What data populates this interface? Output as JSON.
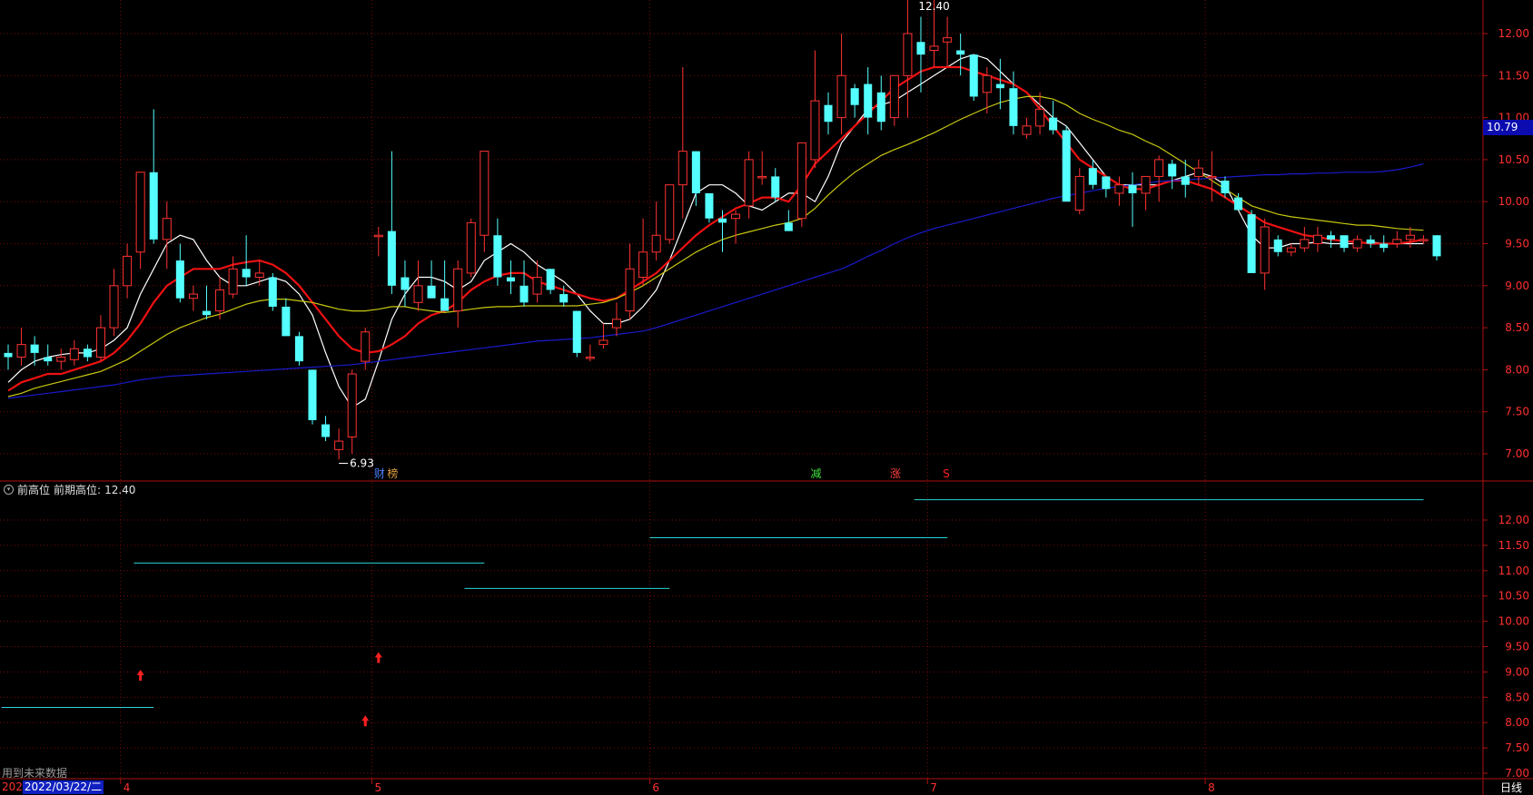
{
  "chart_data": {
    "type": "candlestick",
    "period": "日线",
    "price_axis": {
      "min": 6.7,
      "max": 12.55,
      "ticks": [
        "12.00",
        "11.50",
        "11.00",
        "10.50",
        "10.00",
        "9.50",
        "9.00",
        "8.50",
        "8.00",
        "7.50",
        "7.00"
      ]
    },
    "current_price_label": "10.79",
    "indicator_axis": {
      "min": 6.7,
      "max": 12.55,
      "ticks": [
        "12.00",
        "11.50",
        "11.00",
        "10.50",
        "10.00",
        "9.50",
        "9.00",
        "8.50",
        "8.00",
        "7.50",
        "7.00"
      ]
    },
    "month_labels": [
      {
        "label": "4",
        "index": 9
      },
      {
        "label": "5",
        "index": 28
      },
      {
        "label": "6",
        "index": 49
      },
      {
        "label": "7",
        "index": 70
      },
      {
        "label": "8",
        "index": 91
      }
    ],
    "annotations": {
      "high": "12.40",
      "low": "6.93"
    },
    "markers": [
      {
        "text": "财",
        "index": 28,
        "color": "#4a80ff"
      },
      {
        "text": "榜",
        "index": 29,
        "color": "#e0a040"
      },
      {
        "text": "减",
        "index": 61,
        "color": "#40e040"
      },
      {
        "text": "涨",
        "index": 67,
        "color": "#ff4040"
      },
      {
        "text": "S",
        "index": 71,
        "color": "#ff2020"
      }
    ],
    "candles": [
      {
        "o": 8.2,
        "h": 8.3,
        "l": 8.0,
        "c": 8.15
      },
      {
        "o": 8.15,
        "h": 8.5,
        "l": 8.05,
        "c": 8.3
      },
      {
        "o": 8.3,
        "h": 8.4,
        "l": 8.05,
        "c": 8.2
      },
      {
        "o": 8.15,
        "h": 8.3,
        "l": 8.05,
        "c": 8.1
      },
      {
        "o": 8.1,
        "h": 8.25,
        "l": 8.0,
        "c": 8.15
      },
      {
        "o": 8.12,
        "h": 8.35,
        "l": 8.05,
        "c": 8.25
      },
      {
        "o": 8.25,
        "h": 8.3,
        "l": 8.1,
        "c": 8.15
      },
      {
        "o": 8.15,
        "h": 8.65,
        "l": 8.1,
        "c": 8.5
      },
      {
        "o": 8.5,
        "h": 9.2,
        "l": 8.4,
        "c": 9.0
      },
      {
        "o": 9.0,
        "h": 9.5,
        "l": 8.85,
        "c": 9.35
      },
      {
        "o": 9.4,
        "h": 10.35,
        "l": 9.2,
        "c": 10.35
      },
      {
        "o": 10.35,
        "h": 11.1,
        "l": 9.5,
        "c": 9.55
      },
      {
        "o": 9.55,
        "h": 10.0,
        "l": 9.2,
        "c": 9.8
      },
      {
        "o": 9.3,
        "h": 9.5,
        "l": 8.8,
        "c": 8.85
      },
      {
        "o": 8.85,
        "h": 9.0,
        "l": 8.7,
        "c": 8.9
      },
      {
        "o": 8.7,
        "h": 9.0,
        "l": 8.6,
        "c": 8.65
      },
      {
        "o": 8.7,
        "h": 9.1,
        "l": 8.6,
        "c": 8.95
      },
      {
        "o": 8.9,
        "h": 9.35,
        "l": 8.85,
        "c": 9.2
      },
      {
        "o": 9.2,
        "h": 9.6,
        "l": 9.0,
        "c": 9.1
      },
      {
        "o": 9.1,
        "h": 9.3,
        "l": 9.0,
        "c": 9.15
      },
      {
        "o": 9.1,
        "h": 9.15,
        "l": 8.7,
        "c": 8.75
      },
      {
        "o": 8.75,
        "h": 8.85,
        "l": 8.4,
        "c": 8.4
      },
      {
        "o": 8.4,
        "h": 8.45,
        "l": 8.05,
        "c": 8.1
      },
      {
        "o": 8.0,
        "h": 8.0,
        "l": 7.35,
        "c": 7.4
      },
      {
        "o": 7.35,
        "h": 7.45,
        "l": 7.15,
        "c": 7.2
      },
      {
        "o": 7.05,
        "h": 7.3,
        "l": 6.93,
        "c": 7.15
      },
      {
        "o": 7.2,
        "h": 8.0,
        "l": 7.0,
        "c": 7.95
      },
      {
        "o": 8.1,
        "h": 8.5,
        "l": 8.0,
        "c": 8.45
      },
      {
        "o": 9.6,
        "h": 9.7,
        "l": 9.35,
        "c": 9.6
      },
      {
        "o": 9.65,
        "h": 10.6,
        "l": 8.9,
        "c": 9.0
      },
      {
        "o": 9.1,
        "h": 9.3,
        "l": 8.75,
        "c": 8.95
      },
      {
        "o": 8.8,
        "h": 9.3,
        "l": 8.7,
        "c": 9.0
      },
      {
        "o": 9.0,
        "h": 9.3,
        "l": 8.95,
        "c": 8.85
      },
      {
        "o": 8.85,
        "h": 9.3,
        "l": 8.7,
        "c": 8.7
      },
      {
        "o": 8.7,
        "h": 9.3,
        "l": 8.5,
        "c": 9.2
      },
      {
        "o": 9.15,
        "h": 9.8,
        "l": 9.1,
        "c": 9.75
      },
      {
        "o": 9.6,
        "h": 10.6,
        "l": 9.4,
        "c": 10.6
      },
      {
        "o": 9.6,
        "h": 9.8,
        "l": 9.0,
        "c": 9.1
      },
      {
        "o": 9.1,
        "h": 9.3,
        "l": 8.9,
        "c": 9.05
      },
      {
        "o": 9.0,
        "h": 9.3,
        "l": 8.75,
        "c": 8.8
      },
      {
        "o": 8.9,
        "h": 9.3,
        "l": 8.8,
        "c": 9.1
      },
      {
        "o": 9.2,
        "h": 9.2,
        "l": 8.9,
        "c": 8.95
      },
      {
        "o": 8.9,
        "h": 9.0,
        "l": 8.75,
        "c": 8.8
      },
      {
        "o": 8.7,
        "h": 8.7,
        "l": 8.15,
        "c": 8.2
      },
      {
        "o": 8.15,
        "h": 8.3,
        "l": 8.1,
        "c": 8.15
      },
      {
        "o": 8.3,
        "h": 8.55,
        "l": 8.25,
        "c": 8.35
      },
      {
        "o": 8.5,
        "h": 8.8,
        "l": 8.4,
        "c": 8.6
      },
      {
        "o": 8.7,
        "h": 9.5,
        "l": 8.6,
        "c": 9.2
      },
      {
        "o": 9.1,
        "h": 9.8,
        "l": 9.0,
        "c": 9.4
      },
      {
        "o": 9.4,
        "h": 10.0,
        "l": 9.3,
        "c": 9.6
      },
      {
        "o": 9.55,
        "h": 10.2,
        "l": 9.5,
        "c": 10.2
      },
      {
        "o": 10.2,
        "h": 11.6,
        "l": 9.8,
        "c": 10.6
      },
      {
        "o": 10.6,
        "h": 10.6,
        "l": 9.95,
        "c": 10.1
      },
      {
        "o": 10.1,
        "h": 10.1,
        "l": 9.75,
        "c": 9.8
      },
      {
        "o": 9.8,
        "h": 9.9,
        "l": 9.4,
        "c": 9.75
      },
      {
        "o": 9.8,
        "h": 9.9,
        "l": 9.5,
        "c": 9.85
      },
      {
        "o": 9.95,
        "h": 10.6,
        "l": 9.8,
        "c": 10.5
      },
      {
        "o": 10.3,
        "h": 10.6,
        "l": 10.2,
        "c": 10.3
      },
      {
        "o": 10.3,
        "h": 10.4,
        "l": 10.0,
        "c": 10.05
      },
      {
        "o": 9.75,
        "h": 9.9,
        "l": 9.65,
        "c": 9.65
      },
      {
        "o": 9.8,
        "h": 10.7,
        "l": 9.7,
        "c": 10.7
      },
      {
        "o": 10.5,
        "h": 11.8,
        "l": 10.4,
        "c": 11.2
      },
      {
        "o": 11.15,
        "h": 11.3,
        "l": 10.8,
        "c": 10.95
      },
      {
        "o": 11.0,
        "h": 12.0,
        "l": 10.8,
        "c": 11.5
      },
      {
        "o": 11.35,
        "h": 11.4,
        "l": 11.0,
        "c": 11.15
      },
      {
        "o": 11.4,
        "h": 11.6,
        "l": 10.8,
        "c": 11.0
      },
      {
        "o": 11.3,
        "h": 11.5,
        "l": 10.85,
        "c": 10.95
      },
      {
        "o": 11.0,
        "h": 11.5,
        "l": 10.9,
        "c": 11.5
      },
      {
        "o": 11.5,
        "h": 12.5,
        "l": 11.0,
        "c": 12.0
      },
      {
        "o": 11.9,
        "h": 12.2,
        "l": 11.3,
        "c": 11.75
      },
      {
        "o": 11.8,
        "h": 12.4,
        "l": 11.6,
        "c": 11.85
      },
      {
        "o": 11.9,
        "h": 12.2,
        "l": 11.6,
        "c": 11.95
      },
      {
        "o": 11.8,
        "h": 12.0,
        "l": 11.5,
        "c": 11.75
      },
      {
        "o": 11.75,
        "h": 11.75,
        "l": 11.2,
        "c": 11.25
      },
      {
        "o": 11.3,
        "h": 11.6,
        "l": 11.05,
        "c": 11.5
      },
      {
        "o": 11.4,
        "h": 11.7,
        "l": 11.1,
        "c": 11.35
      },
      {
        "o": 11.35,
        "h": 11.55,
        "l": 10.8,
        "c": 10.9
      },
      {
        "o": 10.8,
        "h": 11.0,
        "l": 10.75,
        "c": 10.9
      },
      {
        "o": 10.9,
        "h": 11.3,
        "l": 10.8,
        "c": 11.1
      },
      {
        "o": 11.0,
        "h": 11.2,
        "l": 10.8,
        "c": 10.85
      },
      {
        "o": 10.85,
        "h": 10.9,
        "l": 10.0,
        "c": 10.0
      },
      {
        "o": 9.9,
        "h": 10.4,
        "l": 9.85,
        "c": 10.3
      },
      {
        "o": 10.4,
        "h": 10.5,
        "l": 10.15,
        "c": 10.2
      },
      {
        "o": 10.3,
        "h": 10.3,
        "l": 10.05,
        "c": 10.15
      },
      {
        "o": 10.1,
        "h": 10.3,
        "l": 9.95,
        "c": 10.2
      },
      {
        "o": 10.2,
        "h": 10.35,
        "l": 9.7,
        "c": 10.1
      },
      {
        "o": 10.1,
        "h": 10.3,
        "l": 9.9,
        "c": 10.3
      },
      {
        "o": 10.3,
        "h": 10.55,
        "l": 10.0,
        "c": 10.5
      },
      {
        "o": 10.45,
        "h": 10.5,
        "l": 10.15,
        "c": 10.3
      },
      {
        "o": 10.3,
        "h": 10.5,
        "l": 10.05,
        "c": 10.2
      },
      {
        "o": 10.3,
        "h": 10.5,
        "l": 10.2,
        "c": 10.4
      },
      {
        "o": 10.3,
        "h": 10.6,
        "l": 10.0,
        "c": 10.3
      },
      {
        "o": 10.25,
        "h": 10.3,
        "l": 10.05,
        "c": 10.1
      },
      {
        "o": 10.05,
        "h": 10.1,
        "l": 9.95,
        "c": 9.9
      },
      {
        "o": 9.85,
        "h": 9.9,
        "l": 9.15,
        "c": 9.15
      },
      {
        "o": 9.15,
        "h": 9.8,
        "l": 8.95,
        "c": 9.7
      },
      {
        "o": 9.55,
        "h": 9.6,
        "l": 9.35,
        "c": 9.4
      },
      {
        "o": 9.4,
        "h": 9.5,
        "l": 9.35,
        "c": 9.45
      },
      {
        "o": 9.45,
        "h": 9.7,
        "l": 9.4,
        "c": 9.55
      },
      {
        "o": 9.5,
        "h": 9.7,
        "l": 9.4,
        "c": 9.6
      },
      {
        "o": 9.6,
        "h": 9.65,
        "l": 9.45,
        "c": 9.55
      },
      {
        "o": 9.6,
        "h": 9.6,
        "l": 9.4,
        "c": 9.45
      },
      {
        "o": 9.45,
        "h": 9.6,
        "l": 9.4,
        "c": 9.55
      },
      {
        "o": 9.55,
        "h": 9.6,
        "l": 9.45,
        "c": 9.5
      },
      {
        "o": 9.5,
        "h": 9.6,
        "l": 9.4,
        "c": 9.45
      },
      {
        "o": 9.5,
        "h": 9.65,
        "l": 9.45,
        "c": 9.55
      },
      {
        "o": 9.55,
        "h": 9.7,
        "l": 9.45,
        "c": 9.6
      },
      {
        "o": 9.55,
        "h": 9.6,
        "l": 9.5,
        "c": 9.55
      },
      {
        "o": 9.6,
        "h": 9.6,
        "l": 9.3,
        "c": 9.35
      }
    ],
    "ma_lines": [
      {
        "color": "#ffffff",
        "values": [
          7.85,
          8.0,
          8.1,
          8.15,
          8.18,
          8.2,
          8.2,
          8.25,
          8.35,
          8.5,
          8.9,
          9.2,
          9.5,
          9.6,
          9.55,
          9.3,
          9.1,
          9.0,
          9.0,
          9.05,
          9.1,
          9.05,
          8.9,
          8.65,
          8.2,
          7.8,
          7.55,
          7.65,
          8.1,
          8.6,
          8.9,
          9.1,
          9.1,
          9.05,
          8.95,
          9.05,
          9.3,
          9.4,
          9.5,
          9.4,
          9.25,
          9.15,
          9.05,
          8.9,
          8.7,
          8.55,
          8.55,
          8.6,
          8.75,
          8.95,
          9.3,
          9.7,
          10.1,
          10.2,
          10.2,
          10.1,
          9.95,
          9.9,
          10.0,
          10.1,
          10.1,
          10.0,
          10.3,
          10.7,
          10.9,
          11.1,
          11.15,
          11.2,
          11.3,
          11.4,
          11.5,
          11.6,
          11.7,
          11.75,
          11.7,
          11.55,
          11.4,
          11.3,
          11.15,
          11.0,
          10.9,
          10.7,
          10.5,
          10.3,
          10.2,
          10.2,
          10.2,
          10.2,
          10.25,
          10.3,
          10.35,
          10.3,
          10.2,
          9.9,
          9.6,
          9.45,
          9.45,
          9.5,
          9.5,
          9.52,
          9.5,
          9.5,
          9.5,
          9.52,
          9.5,
          9.5,
          9.5,
          9.5
        ]
      },
      {
        "color": "#ee1111",
        "values": [
          7.75,
          7.85,
          7.9,
          7.95,
          7.95,
          8.0,
          8.05,
          8.1,
          8.2,
          8.35,
          8.55,
          8.8,
          9.0,
          9.1,
          9.2,
          9.2,
          9.2,
          9.25,
          9.28,
          9.3,
          9.25,
          9.15,
          9.0,
          8.8,
          8.6,
          8.4,
          8.25,
          8.2,
          8.22,
          8.3,
          8.4,
          8.55,
          8.65,
          8.7,
          8.8,
          8.95,
          9.05,
          9.12,
          9.15,
          9.15,
          9.05,
          9.0,
          8.95,
          8.9,
          8.85,
          8.82,
          8.85,
          8.95,
          9.05,
          9.15,
          9.3,
          9.45,
          9.6,
          9.72,
          9.82,
          9.92,
          9.98,
          10.05,
          10.05,
          10.0,
          10.2,
          10.45,
          10.6,
          10.75,
          10.9,
          11.05,
          11.2,
          11.35,
          11.45,
          11.55,
          11.6,
          11.6,
          11.6,
          11.55,
          11.5,
          11.45,
          11.4,
          11.3,
          11.1,
          10.9,
          10.7,
          10.5,
          10.4,
          10.3,
          10.2,
          10.15,
          10.15,
          10.2,
          10.25,
          10.25,
          10.2,
          10.15,
          10.05,
          9.95,
          9.85,
          9.75,
          9.7,
          9.65,
          9.6,
          9.58,
          9.55,
          9.53,
          9.52,
          9.5,
          9.5,
          9.5,
          9.52,
          9.55
        ]
      },
      {
        "color": "#c8c810",
        "values": [
          7.68,
          7.72,
          7.78,
          7.82,
          7.86,
          7.9,
          7.94,
          7.98,
          8.05,
          8.12,
          8.22,
          8.32,
          8.42,
          8.5,
          8.56,
          8.62,
          8.66,
          8.72,
          8.78,
          8.82,
          8.84,
          8.84,
          8.82,
          8.8,
          8.76,
          8.72,
          8.7,
          8.7,
          8.72,
          8.75,
          8.75,
          8.72,
          8.7,
          8.68,
          8.7,
          8.72,
          8.74,
          8.75,
          8.75,
          8.76,
          8.76,
          8.76,
          8.76,
          8.76,
          8.78,
          8.8,
          8.85,
          8.92,
          9.0,
          9.1,
          9.2,
          9.3,
          9.4,
          9.48,
          9.55,
          9.6,
          9.64,
          9.68,
          9.72,
          9.75,
          9.8,
          9.92,
          10.08,
          10.22,
          10.35,
          10.45,
          10.55,
          10.62,
          10.68,
          10.75,
          10.82,
          10.9,
          10.98,
          11.05,
          11.12,
          11.18,
          11.22,
          11.25,
          11.25,
          11.22,
          11.15,
          11.05,
          10.98,
          10.92,
          10.85,
          10.8,
          10.72,
          10.65,
          10.55,
          10.45,
          10.35,
          10.25,
          10.15,
          10.05,
          9.95,
          9.9,
          9.85,
          9.82,
          9.8,
          9.78,
          9.76,
          9.74,
          9.72,
          9.72,
          9.7,
          9.68,
          9.67,
          9.66
        ]
      },
      {
        "color": "#1a1acc",
        "values": [
          7.66,
          7.68,
          7.7,
          7.72,
          7.74,
          7.76,
          7.78,
          7.8,
          7.82,
          7.85,
          7.88,
          7.9,
          7.92,
          7.93,
          7.94,
          7.95,
          7.96,
          7.97,
          7.98,
          7.99,
          8.0,
          8.01,
          8.02,
          8.03,
          8.04,
          8.05,
          8.06,
          8.08,
          8.1,
          8.12,
          8.14,
          8.16,
          8.18,
          8.2,
          8.22,
          8.24,
          8.26,
          8.28,
          8.3,
          8.32,
          8.34,
          8.35,
          8.36,
          8.37,
          8.38,
          8.4,
          8.42,
          8.44,
          8.46,
          8.5,
          8.55,
          8.6,
          8.65,
          8.7,
          8.75,
          8.8,
          8.85,
          8.9,
          8.95,
          9.0,
          9.05,
          9.1,
          9.15,
          9.2,
          9.27,
          9.35,
          9.42,
          9.5,
          9.57,
          9.63,
          9.68,
          9.72,
          9.76,
          9.8,
          9.84,
          9.88,
          9.92,
          9.96,
          10.0,
          10.04,
          10.07,
          10.1,
          10.13,
          10.16,
          10.18,
          10.2,
          10.22,
          10.24,
          10.25,
          10.26,
          10.27,
          10.28,
          10.29,
          10.3,
          10.31,
          10.32,
          10.32,
          10.33,
          10.33,
          10.34,
          10.34,
          10.35,
          10.35,
          10.35,
          10.36,
          10.38,
          10.41,
          10.45
        ]
      }
    ],
    "indicator": {
      "name": "前高位",
      "label": "前期高位:",
      "value": "12.40",
      "levels": [
        {
          "from": 0,
          "to": 11,
          "value": 8.3
        },
        {
          "from": 10,
          "to": 36,
          "value": 11.15
        },
        {
          "from": 35,
          "to": 50,
          "value": 10.65
        },
        {
          "from": 49,
          "to": 71,
          "value": 11.65
        },
        {
          "from": 69,
          "to": 107,
          "value": 12.4
        }
      ],
      "arrows": [
        {
          "index": 10,
          "value": 8.9
        },
        {
          "index": 27,
          "value": 8.0
        },
        {
          "index": 28,
          "value": 9.25
        }
      ]
    },
    "footer": {
      "future_note": "用到未来数据",
      "year": "202",
      "date": "2022/03/22/二"
    }
  }
}
